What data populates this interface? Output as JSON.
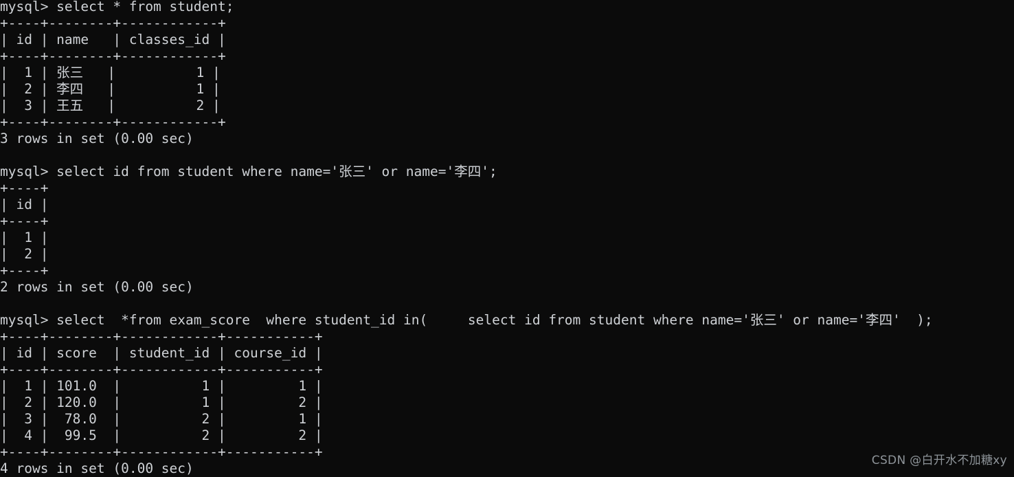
{
  "terminal": {
    "app": "mysql-client-terminal",
    "background_color": "#0b0b0b",
    "text_color": "#cfd2d6",
    "prompt": "mysql>",
    "lines": [
      "mysql> select * from student;",
      "+----+--------+------------+",
      "| id | name   | classes_id |",
      "+----+--------+------------+",
      "|  1 | 张三   |          1 |",
      "|  2 | 李四   |          1 |",
      "|  3 | 王五   |          2 |",
      "+----+--------+------------+",
      "3 rows in set (0.00 sec)",
      "",
      "mysql> select id from student where name='张三' or name='李四';",
      "+----+",
      "| id |",
      "+----+",
      "|  1 |",
      "|  2 |",
      "+----+",
      "2 rows in set (0.00 sec)",
      "",
      "mysql> select  *from exam_score  where student_id in(     select id from student where name='张三' or name='李四'  );",
      "+----+--------+------------+-----------+",
      "| id | score  | student_id | course_id |",
      "+----+--------+------------+-----------+",
      "|  1 | 101.0  |          1 |         1 |",
      "|  2 | 120.0  |          1 |         2 |",
      "|  3 |  78.0  |          2 |         1 |",
      "|  4 |  99.5  |          2 |         2 |",
      "+----+--------+------------+-----------+",
      "4 rows in set (0.00 sec)"
    ],
    "commands": [
      {
        "sql": "select * from student;",
        "result_columns": [
          "id",
          "name",
          "classes_id"
        ],
        "result_rows": [
          [
            "1",
            "张三",
            "1"
          ],
          [
            "2",
            "李四",
            "1"
          ],
          [
            "3",
            "王五",
            "2"
          ]
        ],
        "status": "3 rows in set (0.00 sec)"
      },
      {
        "sql": "select id from student where name='张三' or name='李四';",
        "result_columns": [
          "id"
        ],
        "result_rows": [
          [
            "1"
          ],
          [
            "2"
          ]
        ],
        "status": "2 rows in set (0.00 sec)"
      },
      {
        "sql": "select  *from exam_score  where student_id in(     select id from student where name='张三' or name='李四'  );",
        "result_columns": [
          "id",
          "score",
          "student_id",
          "course_id"
        ],
        "result_rows": [
          [
            "1",
            "101.0",
            "1",
            "1"
          ],
          [
            "2",
            "120.0",
            "1",
            "2"
          ],
          [
            "3",
            "78.0",
            "2",
            "1"
          ],
          [
            "4",
            "99.5",
            "2",
            "2"
          ]
        ],
        "status": "4 rows in set (0.00 sec)"
      }
    ]
  },
  "watermark": {
    "text": "CSDN @白开水不加糖xy"
  }
}
